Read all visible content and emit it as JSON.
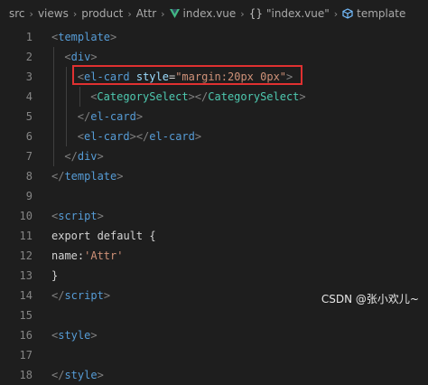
{
  "breadcrumb": {
    "path": [
      "src",
      "views",
      "product",
      "Attr"
    ],
    "file": "index.vue",
    "braces": "{}",
    "object": "\"index.vue\"",
    "section": "template"
  },
  "lines": [
    {
      "n": "1",
      "indent": 0,
      "tokens": [
        {
          "t": "<",
          "c": "punc"
        },
        {
          "t": "template",
          "c": "tag"
        },
        {
          "t": ">",
          "c": "punc"
        }
      ]
    },
    {
      "n": "2",
      "indent": 1,
      "tokens": [
        {
          "t": "<",
          "c": "punc"
        },
        {
          "t": "div",
          "c": "tag"
        },
        {
          "t": ">",
          "c": "punc"
        }
      ]
    },
    {
      "n": "3",
      "indent": 2,
      "tokens": [
        {
          "t": "<",
          "c": "punc"
        },
        {
          "t": "el-card",
          "c": "tag"
        },
        {
          "t": " ",
          "c": "plain"
        },
        {
          "t": "style",
          "c": "attr"
        },
        {
          "t": "=",
          "c": "plain"
        },
        {
          "t": "\"margin:20px 0px\"",
          "c": "str"
        },
        {
          "t": ">",
          "c": "punc"
        }
      ]
    },
    {
      "n": "4",
      "indent": 3,
      "tokens": [
        {
          "t": "<",
          "c": "punc"
        },
        {
          "t": "CategorySelect",
          "c": "comp"
        },
        {
          "t": "></",
          "c": "punc"
        },
        {
          "t": "CategorySelect",
          "c": "comp"
        },
        {
          "t": ">",
          "c": "punc"
        }
      ]
    },
    {
      "n": "5",
      "indent": 2,
      "tokens": [
        {
          "t": "</",
          "c": "punc"
        },
        {
          "t": "el-card",
          "c": "tag"
        },
        {
          "t": ">",
          "c": "punc"
        }
      ]
    },
    {
      "n": "6",
      "indent": 2,
      "tokens": [
        {
          "t": "<",
          "c": "punc"
        },
        {
          "t": "el-card",
          "c": "tag"
        },
        {
          "t": "></",
          "c": "punc"
        },
        {
          "t": "el-card",
          "c": "tag"
        },
        {
          "t": ">",
          "c": "punc"
        }
      ]
    },
    {
      "n": "7",
      "indent": 1,
      "tokens": [
        {
          "t": "</",
          "c": "punc"
        },
        {
          "t": "div",
          "c": "tag"
        },
        {
          "t": ">",
          "c": "punc"
        }
      ]
    },
    {
      "n": "8",
      "indent": 0,
      "tokens": [
        {
          "t": "</",
          "c": "punc"
        },
        {
          "t": "template",
          "c": "tag"
        },
        {
          "t": ">",
          "c": "punc"
        }
      ]
    },
    {
      "n": "9",
      "indent": 0,
      "tokens": []
    },
    {
      "n": "10",
      "indent": 0,
      "tokens": [
        {
          "t": "<",
          "c": "punc"
        },
        {
          "t": "script",
          "c": "tag"
        },
        {
          "t": ">",
          "c": "punc"
        }
      ]
    },
    {
      "n": "11",
      "indent": 0,
      "tokens": [
        {
          "t": "export default {",
          "c": "plain"
        }
      ]
    },
    {
      "n": "12",
      "indent": 0,
      "tokens": [
        {
          "t": "name:",
          "c": "plain"
        },
        {
          "t": "'Attr'",
          "c": "str"
        }
      ]
    },
    {
      "n": "13",
      "indent": 0,
      "tokens": [
        {
          "t": "}",
          "c": "plain"
        }
      ]
    },
    {
      "n": "14",
      "indent": 0,
      "tokens": [
        {
          "t": "</",
          "c": "punc"
        },
        {
          "t": "script",
          "c": "tag"
        },
        {
          "t": ">",
          "c": "punc"
        }
      ]
    },
    {
      "n": "15",
      "indent": 0,
      "tokens": []
    },
    {
      "n": "16",
      "indent": 0,
      "tokens": [
        {
          "t": "<",
          "c": "punc"
        },
        {
          "t": "style",
          "c": "tag"
        },
        {
          "t": ">",
          "c": "punc"
        }
      ]
    },
    {
      "n": "17",
      "indent": 0,
      "tokens": []
    },
    {
      "n": "18",
      "indent": 0,
      "tokens": [
        {
          "t": "</",
          "c": "punc"
        },
        {
          "t": "style",
          "c": "tag"
        },
        {
          "t": ">",
          "c": "punc"
        }
      ]
    }
  ],
  "watermark": "CSDN @张小欢儿~",
  "colors": {
    "background": "#1e1e1e",
    "highlight_box": "#e03131"
  }
}
